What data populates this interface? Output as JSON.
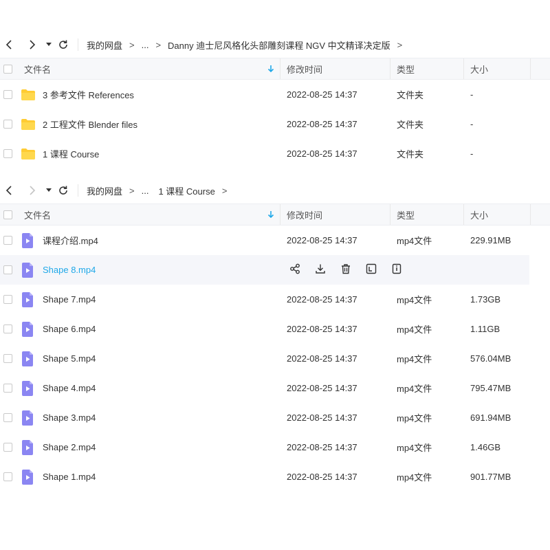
{
  "panel1": {
    "breadcrumb": [
      "我的网盘",
      "...",
      "Danny 迪士尼风格化头部雕刻课程 NGV 中文精译决定版"
    ],
    "columns": {
      "name": "文件名",
      "time": "修改时间",
      "type": "类型",
      "size": "大小"
    },
    "rows": [
      {
        "name": "3 参考文件 References",
        "time": "2022-08-25 14:37",
        "type": "文件夹",
        "size": "-"
      },
      {
        "name": "2 工程文件 Blender files",
        "time": "2022-08-25 14:37",
        "type": "文件夹",
        "size": "-"
      },
      {
        "name": "1 课程 Course",
        "time": "2022-08-25 14:37",
        "type": "文件夹",
        "size": "-"
      }
    ]
  },
  "panel2": {
    "breadcrumb": [
      "我的网盘",
      "...",
      "1 课程 Course"
    ],
    "columns": {
      "name": "文件名",
      "time": "修改时间",
      "type": "类型",
      "size": "大小"
    },
    "rows": [
      {
        "name": "课程介绍.mp4",
        "time": "2022-08-25 14:37",
        "type": "mp4文件",
        "size": "229.91MB"
      },
      {
        "name": "Shape 8.mp4",
        "time": "",
        "type": "",
        "size": ""
      },
      {
        "name": "Shape 7.mp4",
        "time": "2022-08-25 14:37",
        "type": "mp4文件",
        "size": "1.73GB"
      },
      {
        "name": "Shape 6.mp4",
        "time": "2022-08-25 14:37",
        "type": "mp4文件",
        "size": "1.11GB"
      },
      {
        "name": "Shape 5.mp4",
        "time": "2022-08-25 14:37",
        "type": "mp4文件",
        "size": "576.04MB"
      },
      {
        "name": "Shape 4.mp4",
        "time": "2022-08-25 14:37",
        "type": "mp4文件",
        "size": "795.47MB"
      },
      {
        "name": "Shape 3.mp4",
        "time": "2022-08-25 14:37",
        "type": "mp4文件",
        "size": "691.94MB"
      },
      {
        "name": "Shape 2.mp4",
        "time": "2022-08-25 14:37",
        "type": "mp4文件",
        "size": "1.46GB"
      },
      {
        "name": "Shape 1.mp4",
        "time": "2022-08-25 14:37",
        "type": "mp4文件",
        "size": "901.77MB"
      }
    ]
  },
  "breadcrumb_separator": ">",
  "hover_actions": [
    "share-icon",
    "download-icon",
    "delete-icon",
    "rename-icon",
    "more-info-icon"
  ],
  "colors": {
    "accent": "#1fa8e8",
    "folder": "#ffcc33",
    "video": "#8b86f2",
    "hover_row": "#f5f6fa"
  }
}
